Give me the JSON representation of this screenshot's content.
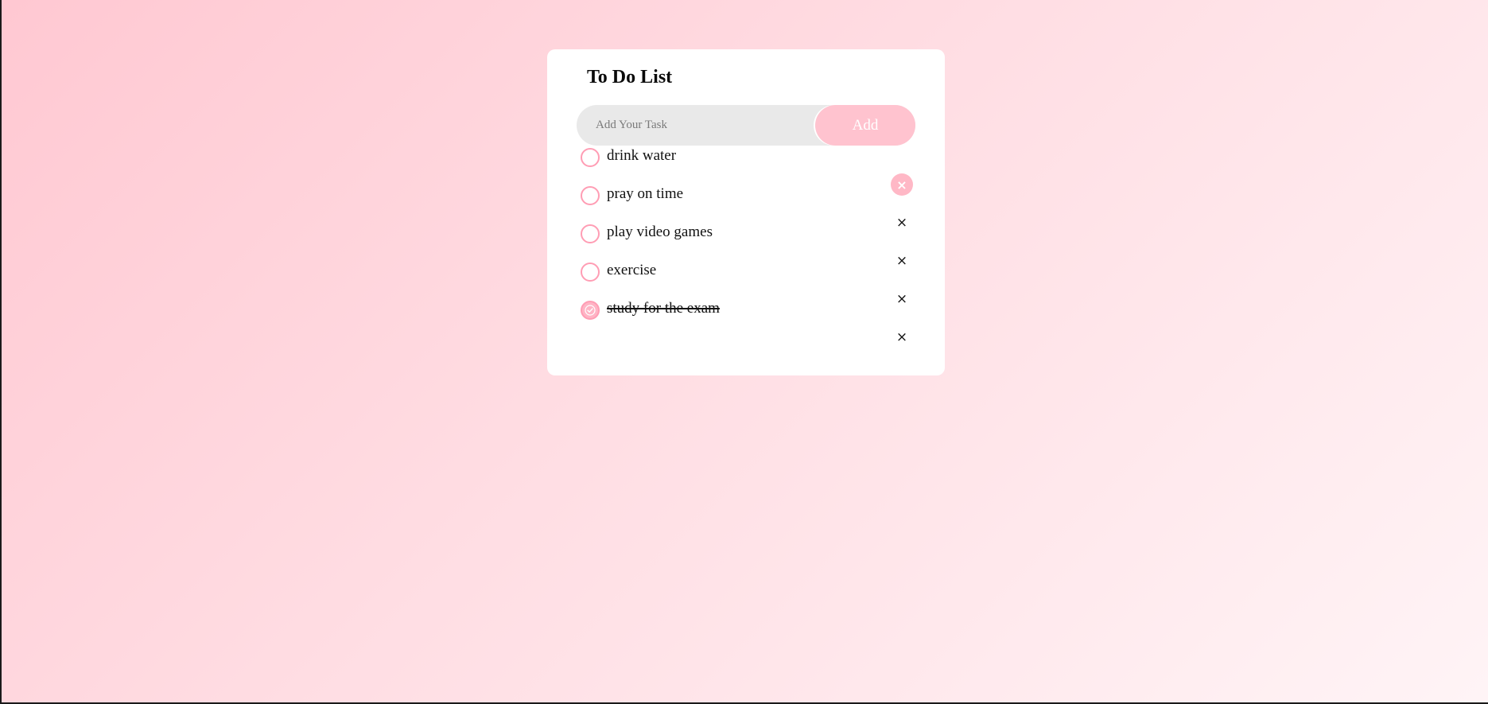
{
  "app": {
    "title": "To Do List"
  },
  "input": {
    "placeholder": "Add Your Task",
    "value": ""
  },
  "add_button": {
    "label": "Add"
  },
  "colors": {
    "accent": "#ffc3cf",
    "check_border": "#ff9db4",
    "card_bg": "#ffffff",
    "input_bg": "#e9e9e9"
  },
  "tasks": [
    {
      "label": "drink water",
      "done": false,
      "delete_icon": "close-icon"
    },
    {
      "label": "pray on time",
      "done": false,
      "delete_icon": "close-icon"
    },
    {
      "label": "play video games",
      "done": false,
      "delete_icon": "close-icon"
    },
    {
      "label": "exercise",
      "done": false,
      "delete_icon": "close-icon"
    },
    {
      "label": "study for the exam",
      "done": true,
      "delete_icon": "close-icon"
    }
  ],
  "delete_glyph": "×"
}
